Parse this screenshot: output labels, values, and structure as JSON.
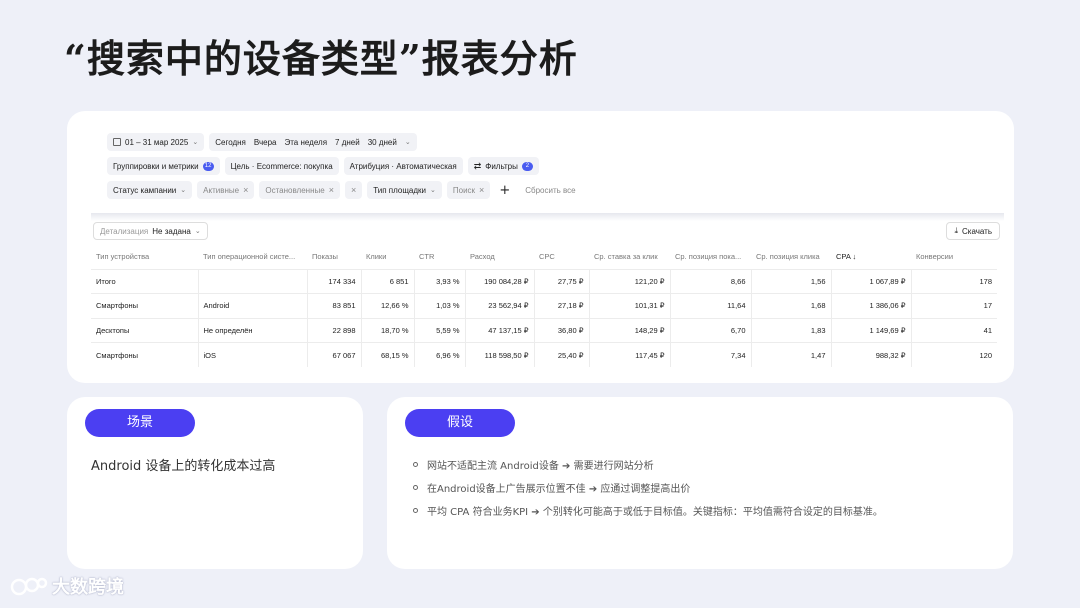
{
  "title": "“搜索中的设备类型”报表分析",
  "filters": {
    "date_range": "01 – 31 мар 2025",
    "quick_periods": [
      "Сегодня",
      "Вчера",
      "Эта неделя",
      "7 дней",
      "30 дней"
    ],
    "groupings_label": "Группировки и метрики",
    "groupings_badge": "12",
    "goal_label": "Цель · Ecommerce: покупка",
    "attribution_label": "Атрибуция · Автоматическая",
    "filters_label": "Фильтры",
    "filters_badge": "2",
    "campaign_status_label": "Статус кампании",
    "status_active": "Активные",
    "status_stopped": "Остановленные",
    "placement_type_label": "Тип площадки",
    "placement_search": "Поиск",
    "reset_label": "Сбросить все"
  },
  "toolbar": {
    "detail_label": "Детализация",
    "detail_value": "Не задана",
    "download_label": "Скачать"
  },
  "table": {
    "headers": [
      "Тип устройства",
      "Тип операционной систе...",
      "Показы",
      "Клики",
      "CTR",
      "Расход",
      "CPC",
      "Ср. ставка за клик",
      "Ср. позиция пока...",
      "Ср. позиция клика",
      "CPA ↓",
      "Конверсии"
    ],
    "rows": [
      [
        "Итого",
        "",
        "174 334",
        "6 851",
        "3,93 %",
        "190 084,28 ₽",
        "27,75 ₽",
        "121,20 ₽",
        "8,66",
        "1,56",
        "1 067,89 ₽",
        "178"
      ],
      [
        "Смартфоны",
        "Android",
        "83 851",
        "12,66 %",
        "1,03 %",
        "23 562,94 ₽",
        "27,18 ₽",
        "101,31 ₽",
        "11,64",
        "1,68",
        "1 386,06 ₽",
        "17"
      ],
      [
        "Десктопы",
        "Не определён",
        "22 898",
        "18,70 %",
        "5,59 %",
        "47 137,15 ₽",
        "36,80 ₽",
        "148,29 ₽",
        "6,70",
        "1,83",
        "1 149,69 ₽",
        "41"
      ],
      [
        "Смартфоны",
        "iOS",
        "67 067",
        "68,15 %",
        "6,96 %",
        "118 598,50 ₽",
        "25,40 ₽",
        "117,45 ₽",
        "7,34",
        "1,47",
        "988,32 ₽",
        "120"
      ]
    ]
  },
  "scene": {
    "pill": "场景",
    "text": "Android 设备上的转化成本过高"
  },
  "hypothesis": {
    "pill": "假设",
    "items": [
      "网站不适配主流 Android设备 ➔ 需要进行网站分析",
      "在Android设备上广告展示位置不佳 ➔ 应通过调整提高出价",
      "平均 CPA 符合业务KPI ➔ 个别转化可能高于或低于目标值。关键指标：平均值需符合设定的目标基准。"
    ]
  },
  "watermark": "大数跨境"
}
